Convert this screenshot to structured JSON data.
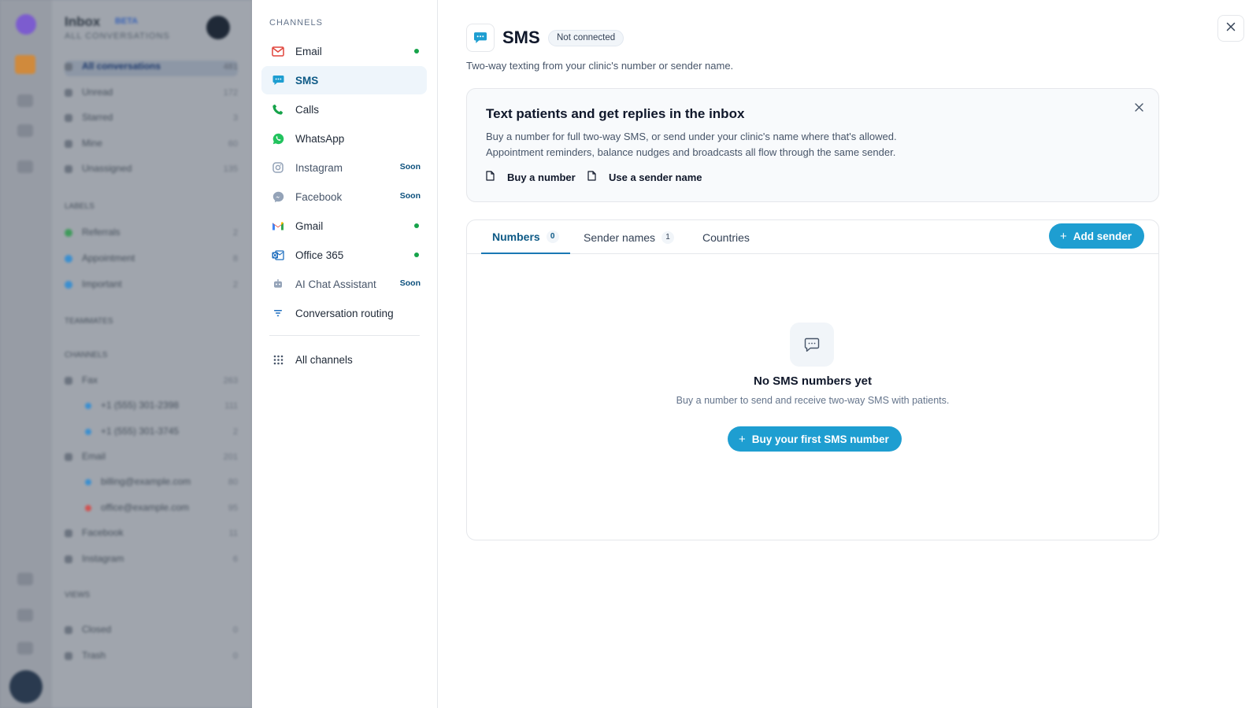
{
  "background": {
    "title": "Inbox",
    "beta": "BETA",
    "subtitle": "ALL CONVERSATIONS",
    "rows": [
      {
        "label": "All conversations",
        "count": "481"
      },
      {
        "label": "Unread",
        "count": "172"
      },
      {
        "label": "Starred",
        "count": "3"
      },
      {
        "label": "Mine",
        "count": "60"
      },
      {
        "label": "Unassigned",
        "count": "135"
      },
      {
        "label": "LABELS",
        "count": ""
      },
      {
        "label": "Referrals",
        "count": "2"
      },
      {
        "label": "Appointment",
        "count": "8"
      },
      {
        "label": "Important",
        "count": "2"
      },
      {
        "label": "TEAMMATES",
        "count": ""
      },
      {
        "label": "CHANNELS",
        "count": ""
      },
      {
        "label": "Fax",
        "count": "263"
      },
      {
        "label": "+1 (555) 301-2398",
        "count": "111"
      },
      {
        "label": "+1 (555) 301-3745",
        "count": "2"
      },
      {
        "label": "Email",
        "count": "201"
      },
      {
        "label": "billing@example.com",
        "count": "80"
      },
      {
        "label": "office@example.com",
        "count": "95"
      },
      {
        "label": "Facebook",
        "count": "11"
      },
      {
        "label": "Instagram",
        "count": "6"
      },
      {
        "label": "VIEWS",
        "count": ""
      },
      {
        "label": "Closed",
        "count": "0"
      },
      {
        "label": "Trash",
        "count": "0"
      }
    ]
  },
  "channels": {
    "heading": "CHANNELS",
    "items": [
      {
        "label": "Email",
        "icon": "mail-icon",
        "status": "connected"
      },
      {
        "label": "SMS",
        "icon": "sms-icon",
        "status": "active"
      },
      {
        "label": "Calls",
        "icon": "phone-icon",
        "status": "none"
      },
      {
        "label": "WhatsApp",
        "icon": "whatsapp-icon",
        "status": "none"
      },
      {
        "label": "Instagram",
        "icon": "instagram-icon",
        "badge": "Soon"
      },
      {
        "label": "Facebook",
        "icon": "messenger-icon",
        "badge": "Soon"
      },
      {
        "label": "Gmail",
        "icon": "gmail-icon",
        "status": "connected"
      },
      {
        "label": "Office 365",
        "icon": "outlook-icon",
        "status": "connected"
      },
      {
        "label": "AI Chat Assistant",
        "icon": "bot-icon",
        "badge": "Soon"
      },
      {
        "label": "Conversation routing",
        "icon": "filter-icon",
        "status": "none"
      }
    ],
    "all_channels": "All channels"
  },
  "main": {
    "title": "SMS",
    "status_badge": "Not connected",
    "description": "Two-way texting from your clinic's number or sender name.",
    "info": {
      "title": "Text patients and get replies in the inbox",
      "line1": "Buy a number for full two-way SMS, or send under your clinic's name where that's allowed.",
      "line2": "Appointment reminders, balance nudges and broadcasts all flow through the same sender.",
      "link_buy": "Buy a number",
      "link_sender": "Use a sender name"
    },
    "tabs": [
      {
        "label": "Numbers",
        "count": "0"
      },
      {
        "label": "Sender names",
        "count": "1"
      },
      {
        "label": "Countries",
        "count": ""
      }
    ],
    "add_sender": "Add sender",
    "empty": {
      "title": "No SMS numbers yet",
      "description": "Buy a number to send and receive two-way SMS with patients.",
      "button": "Buy your first SMS number"
    }
  },
  "colors": {
    "accent": "#1e9ed1",
    "active_text": "#0e5a86",
    "connected": "#16a34a",
    "soon": "#0b4f7c"
  }
}
